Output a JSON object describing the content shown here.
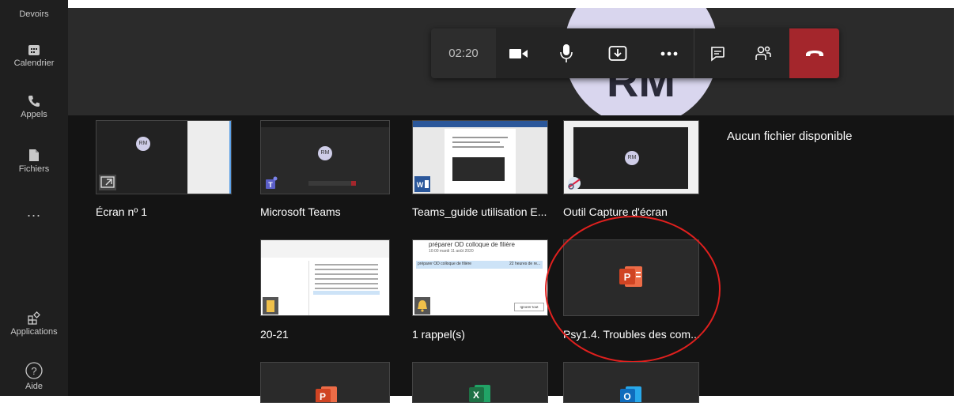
{
  "rail": {
    "items": [
      {
        "label": "Devoirs",
        "icon": "assignments-icon"
      },
      {
        "label": "Calendrier",
        "icon": "calendar-icon"
      },
      {
        "label": "Appels",
        "icon": "phone-icon"
      },
      {
        "label": "Fichiers",
        "icon": "file-icon"
      },
      {
        "label": "...",
        "icon": "more-icon"
      },
      {
        "label": "Applications",
        "icon": "apps-icon"
      },
      {
        "label": "Aide",
        "icon": "help-icon"
      }
    ]
  },
  "call": {
    "avatar_initials": "RM",
    "timer": "02:20",
    "buttons": [
      "camera-icon",
      "microphone-icon",
      "share-tray-icon",
      "more-actions-icon",
      "chat-icon",
      "participants-icon",
      "hang-up-icon"
    ],
    "hangup_color": "#a4262c"
  },
  "share": {
    "no_files_text": "Aucun fichier disponible",
    "windows": [
      {
        "label": "Écran nº 1",
        "app_icon": "screen-share-icon",
        "avatar": "RM"
      },
      {
        "label": "Microsoft Teams",
        "app_icon": "teams-icon",
        "avatar": "RM"
      },
      {
        "label": "Teams_guide utilisation E...",
        "app_icon": "word-icon"
      },
      {
        "label": "Outil Capture d'écran",
        "app_icon": "snipping-tool-icon",
        "avatar": "RM"
      },
      {
        "label": "20-21",
        "app_icon": "folder-icon"
      },
      {
        "label": "1 rappel(s)",
        "app_icon": "bell-icon",
        "reminder_title": "préparer OD colloque de filière",
        "reminder_subtitle": "10:00 mardi 11 août 2020",
        "reminder_item": "préparer OD colloque de filière",
        "reminder_due": "22 heures de re...",
        "reminder_button": "Ignorer tout"
      },
      {
        "label": "Psy1.4. Troubles des com...",
        "app_icon": "powerpoint-icon"
      }
    ],
    "bottom_row_icons": [
      "powerpoint-icon",
      "excel-icon",
      "outlook-icon"
    ]
  },
  "colors": {
    "highlight_circle": "#e0201e",
    "powerpoint": "#d04423",
    "excel": "#1e7145",
    "outlook": "#0f6cbd",
    "word": "#2b579a",
    "teams": "#5b5fc7"
  }
}
